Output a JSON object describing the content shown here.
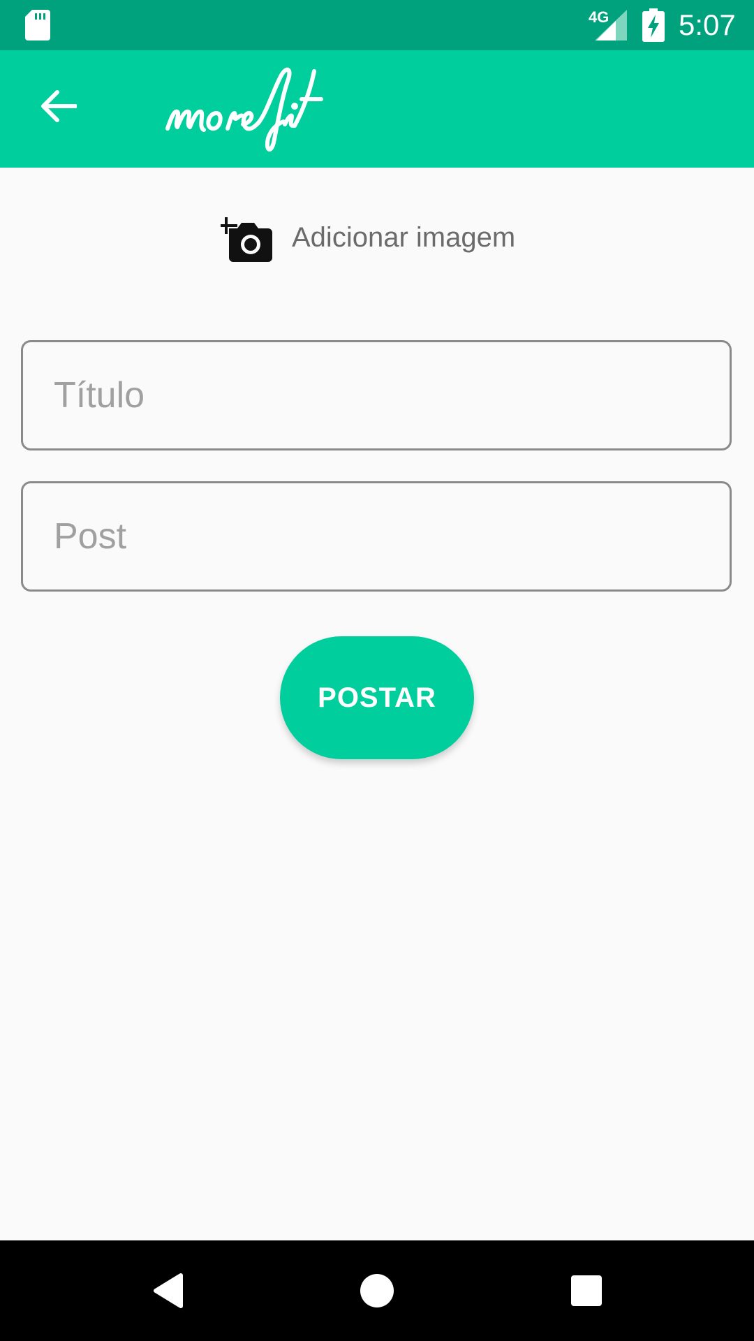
{
  "status_bar": {
    "time": "5:07",
    "network": "4G",
    "icons": [
      "sd-card-icon",
      "signal-icon",
      "battery-charging-icon"
    ]
  },
  "app_bar": {
    "logo_text": "morefit",
    "back_icon": "arrow-left-icon"
  },
  "add_image": {
    "icon": "add-camera-icon",
    "label": "Adicionar imagem"
  },
  "form": {
    "title_placeholder": "Título",
    "title_value": "",
    "post_placeholder": "Post",
    "post_value": "",
    "submit_label": "POSTAR"
  },
  "nav_bar": {
    "icons": [
      "back-triangle-icon",
      "home-circle-icon",
      "recents-square-icon"
    ]
  },
  "colors": {
    "status_bar": "#00A27E",
    "primary": "#00CE9C",
    "background": "#FAFAFA",
    "field_border": "#8A8A8A",
    "placeholder": "#A0A0A0",
    "label": "#6B6B6B"
  }
}
